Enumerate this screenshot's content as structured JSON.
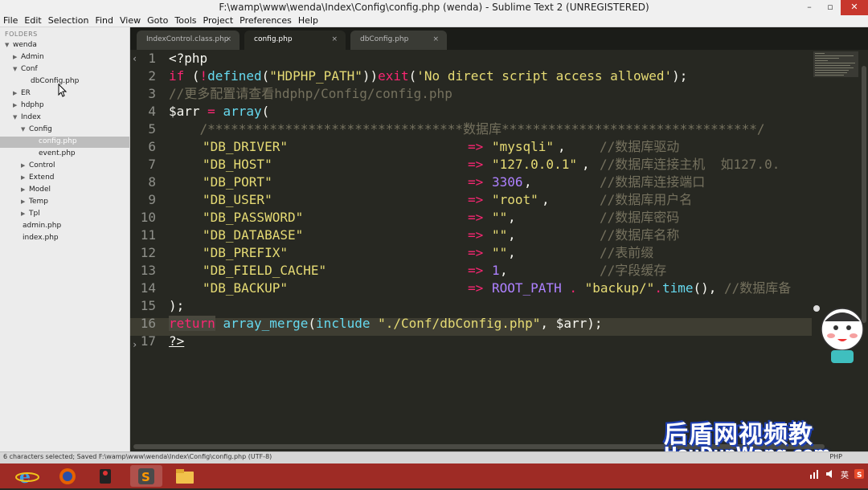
{
  "window": {
    "title": "F:\\wamp\\www\\wenda\\Index\\Config\\config.php (wenda) - Sublime Text 2 (UNREGISTERED)",
    "controls": [
      "–",
      "▫",
      "✕"
    ]
  },
  "menu": [
    "File",
    "Edit",
    "Selection",
    "Find",
    "View",
    "Goto",
    "Tools",
    "Project",
    "Preferences",
    "Help"
  ],
  "sidebar": {
    "header": "FOLDERS",
    "items": [
      {
        "label": "wenda",
        "arrow": "▼"
      },
      {
        "label": "Admin",
        "arrow": "▶"
      },
      {
        "label": "Conf",
        "arrow": "▼"
      },
      {
        "label": "dbConfig.php",
        "arrow": ""
      },
      {
        "label": "ER",
        "arrow": "▶"
      },
      {
        "label": "hdphp",
        "arrow": "▶"
      },
      {
        "label": "Index",
        "arrow": "▼"
      },
      {
        "label": "Config",
        "arrow": "▼"
      },
      {
        "label": "config.php",
        "arrow": ""
      },
      {
        "label": "event.php",
        "arrow": ""
      },
      {
        "label": "Control",
        "arrow": "▶"
      },
      {
        "label": "Extend",
        "arrow": "▶"
      },
      {
        "label": "Model",
        "arrow": "▶"
      },
      {
        "label": "Temp",
        "arrow": "▶"
      },
      {
        "label": "Tpl",
        "arrow": "▶"
      },
      {
        "label": "admin.php",
        "arrow": ""
      },
      {
        "label": "index.php",
        "arrow": ""
      }
    ]
  },
  "tabs": [
    {
      "label": "IndexControl.class.php",
      "close": "×"
    },
    {
      "label": "config.php",
      "close": "×"
    },
    {
      "label": "dbConfig.php",
      "close": "×"
    }
  ],
  "gutter": {
    "line_numbers": [
      "1",
      "2",
      "3",
      "4",
      "5",
      "6",
      "7",
      "8",
      "9",
      "10",
      "11",
      "12",
      "13",
      "14",
      "15",
      "16",
      "17"
    ],
    "fold_marker_top": "‹",
    "fold_marker_17": "›"
  },
  "code": {
    "l1": "<?php",
    "l2a": "if",
    "l2b": " (",
    "l2c": "!",
    "l2d": "defined",
    "l2e": "(",
    "l2f": "\"HDPHP_PATH\"",
    "l2g": "))",
    "l2h": "exit",
    "l2i": "(",
    "l2j": "'No direct script access allowed'",
    "l2k": ");",
    "l3": "//更多配置请查看hdphp/Config/config.php",
    "l4a": "$arr",
    "l4b": " = ",
    "l4c": "array",
    "l4d": "(",
    "l5": "    /*********************************数据库*********************************/",
    "rows": [
      {
        "key": "\"DB_DRIVER\"",
        "arrow": "=>",
        "val": "\"mysqli\"",
        "sep": ",",
        "comment": "//数据库驱动"
      },
      {
        "key": "\"DB_HOST\"",
        "arrow": "=>",
        "val": "\"127.0.0.1\"",
        "sep": ",",
        "comment": "//数据库连接主机  如127.0."
      },
      {
        "key": "\"DB_PORT\"",
        "arrow": "=>",
        "val": "3306",
        "sep": ",",
        "comment": "//数据库连接端口"
      },
      {
        "key": "\"DB_USER\"",
        "arrow": "=>",
        "val": "\"root\"",
        "sep": ",",
        "comment": "//数据库用户名"
      },
      {
        "key": "\"DB_PASSWORD\"",
        "arrow": "=>",
        "val": "\"\"",
        "sep": ",",
        "comment": "//数据库密码"
      },
      {
        "key": "\"DB_DATABASE\"",
        "arrow": "=>",
        "val": "\"\"",
        "sep": ",",
        "comment": "//数据库名称"
      },
      {
        "key": "\"DB_PREFIX\"",
        "arrow": "=>",
        "val": "\"\"",
        "sep": ",",
        "comment": "//表前缀"
      },
      {
        "key": "\"DB_FIELD_CACHE\"",
        "arrow": "=>",
        "val": "1",
        "sep": ",",
        "comment": "//字段缓存"
      }
    ],
    "l14key": "\"DB_BACKUP\"",
    "l14arrow": "=>",
    "l14a": "ROOT_PATH",
    "l14b": " . ",
    "l14c": "\"backup/\"",
    "l14d": ".",
    "l14e": "time",
    "l14f": "(), ",
    "l14g": "//数据库备",
    "l15": ");",
    "l16a": "return",
    "l16b": " ",
    "l16c": "array_merge",
    "l16d": "(",
    "l16e": "include",
    "l16f": " ",
    "l16g": "\"./Conf/dbConfig.php\"",
    "l16h": ", ",
    "l16i": "$arr",
    "l16j": ");",
    "l17": "?>"
  },
  "status": {
    "text": "6 characters selected; Saved F:\\wamp\\www\\wenda\\Index\\Config\\config.php (UTF-8)",
    "syntax": "PHP"
  },
  "tray": [
    "英"
  ],
  "watermark": {
    "cn": "后盾网视频教程",
    "en": "HouDunWang.com"
  },
  "colors": {
    "bg": "#272822",
    "keyword": "#f92672",
    "function": "#66d9ef",
    "string": "#e6db74",
    "comment": "#75715e",
    "number": "#ae81ff",
    "variable": "#f8f8f2",
    "taskbar": "#9e2b25"
  }
}
